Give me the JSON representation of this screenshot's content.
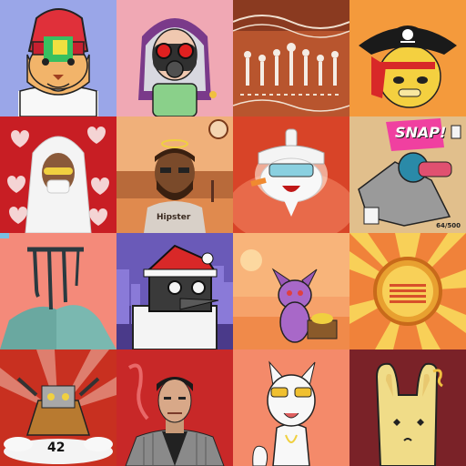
{
  "gallery": {
    "tiles": [
      {
        "name": "lion-boxer",
        "bg": "#9aa6e8"
      },
      {
        "name": "gasmask-girl",
        "bg": "#f0a8b4"
      },
      {
        "name": "tribal-pattern",
        "bg": "#b8552e"
      },
      {
        "name": "pirate-cat",
        "bg": "#f49a3c"
      },
      {
        "name": "heart-hoodie",
        "bg": "#c81e24"
      },
      {
        "name": "hipster",
        "bg": "#e08a4e",
        "text": "Hipster"
      },
      {
        "name": "chef-cat",
        "bg": "#d84428"
      },
      {
        "name": "snap-comic",
        "bg": "#f2c47a",
        "text": "SNAP!",
        "footer": "64/500"
      },
      {
        "name": "drip-rock",
        "bg": "#f48a7a"
      },
      {
        "name": "santa-crow",
        "bg": "#6a5ab8"
      },
      {
        "name": "sphynx-cat",
        "bg": "#f6a26a"
      },
      {
        "name": "sun-badge",
        "bg": "#f0823a"
      },
      {
        "name": "robot-42",
        "bg": "#c83020",
        "text": "42"
      },
      {
        "name": "suit-man",
        "bg": "#c82828"
      },
      {
        "name": "white-cat",
        "bg": "#f48a6a"
      },
      {
        "name": "bunny",
        "bg": "#7a2228"
      }
    ]
  }
}
